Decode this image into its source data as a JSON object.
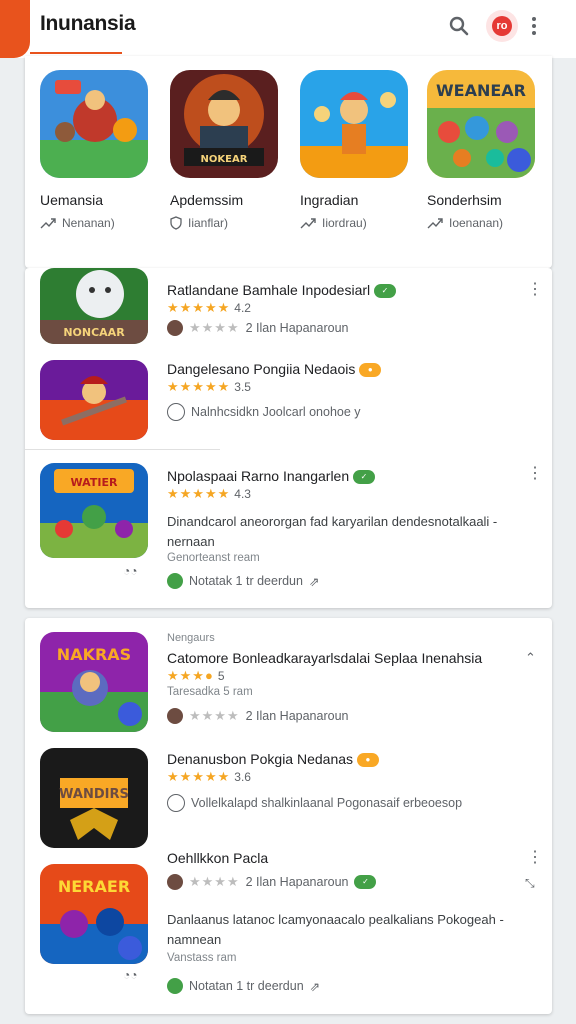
{
  "app": {
    "title": "Inunansia"
  },
  "featured": [
    {
      "name": "Uemansia",
      "meta": "Nenanan)",
      "icon": "trending-icon"
    },
    {
      "name": "Apdemssim",
      "meta": "Iianflar)",
      "icon": "shield-icon"
    },
    {
      "name": "Ingradian",
      "meta": "Iiordrau)",
      "icon": "trending-icon"
    },
    {
      "name": "Sonderhsim",
      "meta": "Ioenanan)",
      "icon": "trending-icon"
    }
  ],
  "list1": [
    {
      "title": "Ratlandane Bamhale Inpodesiarl",
      "rating_text": "4.2",
      "line": "2 Ilan  Hapanaroun",
      "art_text": "NONCAAR"
    },
    {
      "title": "Dangelesano Pongiia Nedaois",
      "rating_text": "3.5",
      "line": "Nalnhcsidkn Joolcarl onohoe y"
    },
    {
      "title": "Npolaspaai Rarno Inangarlen",
      "rating_text": "4.3",
      "desc": "Dinandcarol aneororgan fad karyarilan dendesnotalkaali - nernaan",
      "sub": "Genorteanst ream",
      "line": "Notatak  1  tr  deerdun"
    }
  ],
  "list2": {
    "section_label": "Nengaurs",
    "items": [
      {
        "title": "Catomore Bonleadkarayarlsdalai Seplaa Inenahsia",
        "rating_text": "5",
        "sub": "Taresadka  5  ram",
        "line": "2 Ilan  Hapanaroun",
        "art_text": "NAKRAS"
      },
      {
        "title": "Denanusbon Pokgia Nedanas",
        "rating_text": "3.6",
        "line": "Vollelkalapd shalkinlaanal Pogonasaif erbeoesop",
        "art_text": "WANDIRS"
      },
      {
        "title": "Oehllkkon Pacla",
        "line": "2 Ilan  Hapanaroun",
        "desc": "Danlaanus latanoc lcamyonaacalo pealkalians Pokogeah - namnean",
        "sub": "Vanstass ram",
        "line2": "Notatan  1  tr  deerdun",
        "art_text": "NERAER"
      }
    ]
  },
  "colors": {
    "accent": "#e8531d",
    "star": "#f5a623",
    "badge_green": "#43a047"
  }
}
